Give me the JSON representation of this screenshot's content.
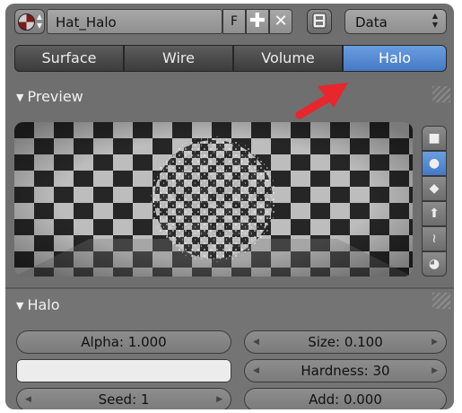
{
  "header": {
    "material_name": "Hat_Halo",
    "fake_user_label": "F",
    "new_icon": "plus-icon",
    "delete_icon": "x-icon",
    "pin_icon": "pin-icon",
    "data_dropdown": "Data"
  },
  "tabs": [
    {
      "label": "Surface",
      "active": false
    },
    {
      "label": "Wire",
      "active": false
    },
    {
      "label": "Volume",
      "active": false
    },
    {
      "label": "Halo",
      "active": true
    }
  ],
  "preview": {
    "title": "Preview",
    "side_buttons": [
      "plane-icon",
      "sphere-icon",
      "cube-icon",
      "monkey-icon",
      "hair-icon",
      "sky-icon"
    ],
    "selected": "sphere-icon"
  },
  "halo": {
    "title": "Halo",
    "alpha": "Alpha: 1.000",
    "size": "Size: 0.100",
    "hardness": "Hardness: 30",
    "seed": "Seed: 1",
    "add": "Add: 0.000",
    "color": "#ececec"
  },
  "colors": {
    "accent": "#5b8fd6",
    "arrow": "#e8262c"
  }
}
